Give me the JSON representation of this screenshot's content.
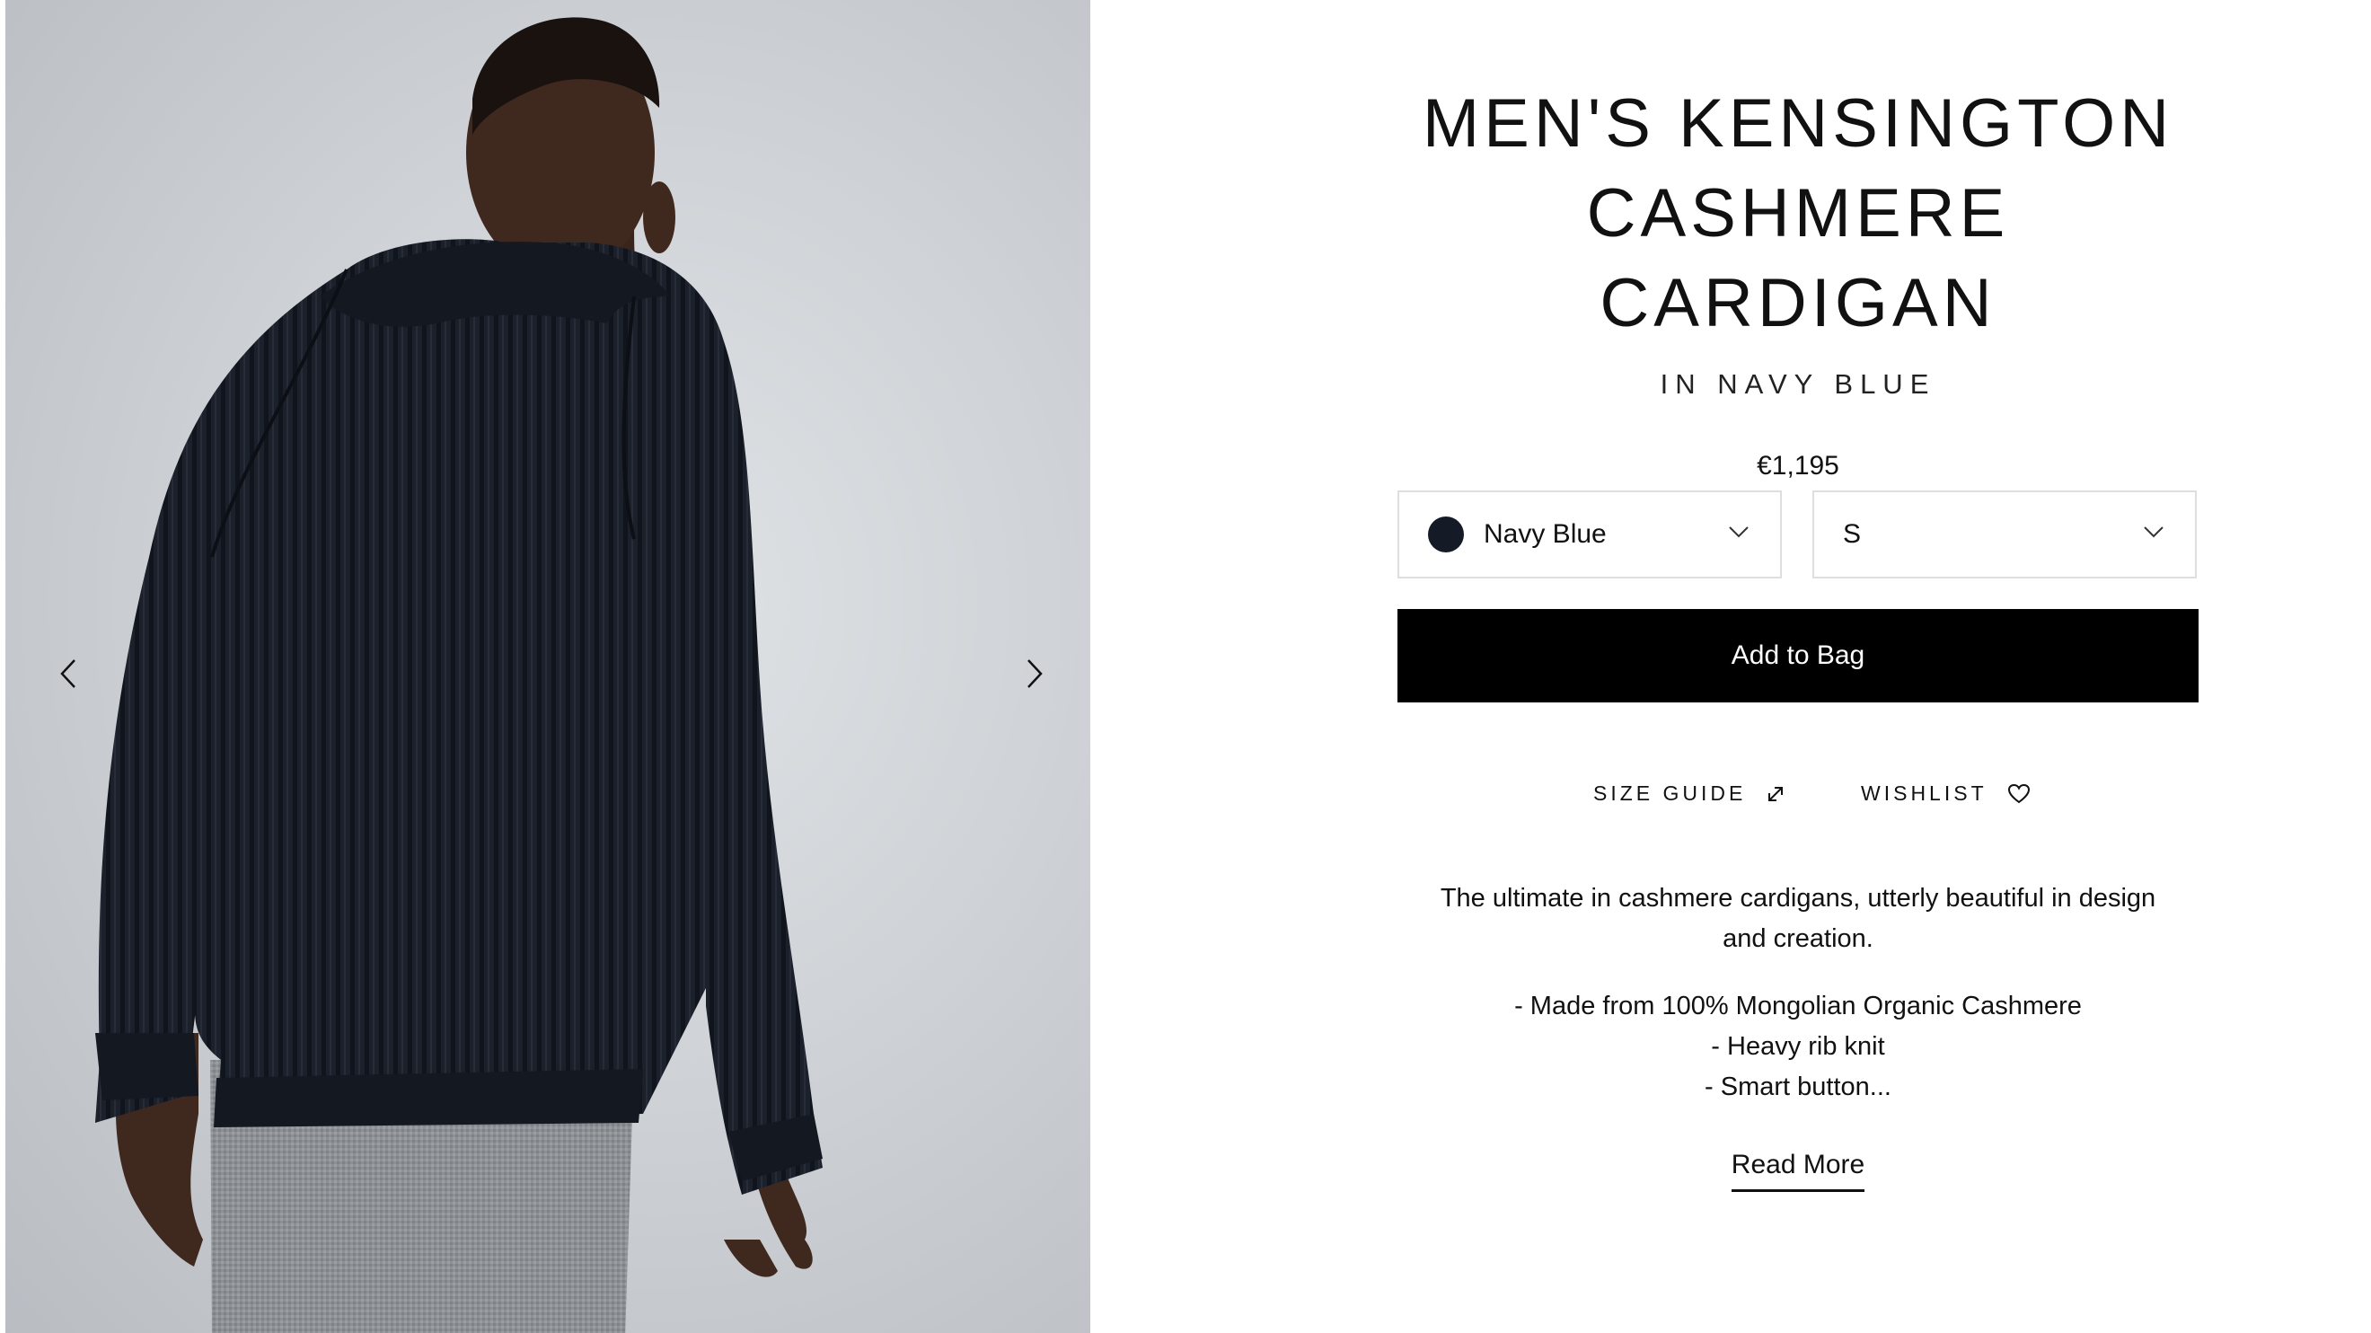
{
  "product": {
    "title_line1": "MEN'S KENSINGTON",
    "title_line2": "CASHMERE CARDIGAN",
    "subtitle": "IN NAVY BLUE",
    "price": "€1,195"
  },
  "gallery": {
    "prev_icon": "chevron-left-icon",
    "next_icon": "chevron-right-icon"
  },
  "selectors": {
    "color": {
      "selected": "Navy Blue",
      "swatch_color": "#141a26"
    },
    "size": {
      "selected": "S"
    }
  },
  "actions": {
    "add_to_bag": "Add to Bag",
    "size_guide": "SIZE GUIDE",
    "size_guide_icon": "expand-arrow-icon",
    "wishlist": "WISHLIST",
    "wishlist_icon": "heart-icon"
  },
  "description": {
    "intro": "The ultimate in cashmere cardigans, utterly beautiful in design and creation.",
    "bullets": [
      "- Made from 100% Mongolian Organic Cashmere",
      "- Heavy rib knit",
      "- Smart button..."
    ],
    "read_more": "Read More"
  },
  "colors": {
    "button_bg": "#000000",
    "select_border": "#dedede",
    "knit": "#1a1f2a",
    "skin": "#4a3024",
    "trousers": "#8e9194"
  }
}
